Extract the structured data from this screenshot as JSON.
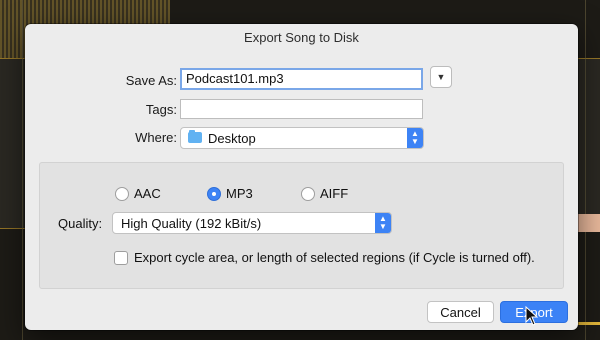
{
  "dialog": {
    "title": "Export Song to Disk",
    "save_as_label": "Save As:",
    "save_as_value": "Podcast101.mp3",
    "tags_label": "Tags:",
    "tags_value": "",
    "where_label": "Where:",
    "where_value": "Desktop",
    "expand_icon": "chevron-down-icon",
    "formats": [
      {
        "label": "AAC",
        "selected": false
      },
      {
        "label": "MP3",
        "selected": true
      },
      {
        "label": "AIFF",
        "selected": false
      }
    ],
    "quality_label": "Quality:",
    "quality_value": "High Quality (192 kBit/s)",
    "cycle_checkbox_label": "Export cycle area, or length of selected regions (if Cycle is turned off).",
    "cycle_checked": false,
    "cancel_label": "Cancel",
    "export_label": "Export"
  },
  "colors": {
    "accent": "#3b82f6",
    "dialog_bg": "#ececec",
    "background": "#1d1b16"
  }
}
